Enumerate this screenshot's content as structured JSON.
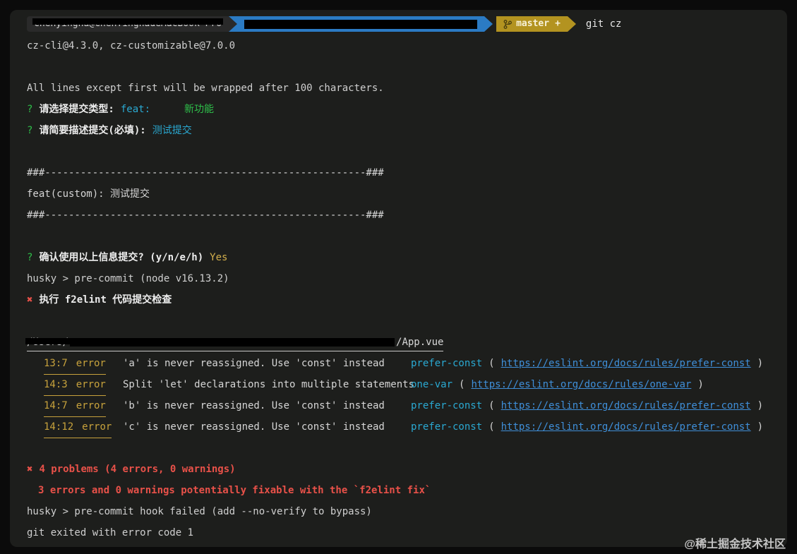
{
  "watermark": "@稀土掘金技术社区",
  "terminal": {
    "prompt": {
      "user_host": "chenyingha@ChenYinghadeMacBook-Pro",
      "branch": "master",
      "branch_dirty": "+",
      "command": "git cz"
    },
    "output": {
      "version_line": "cz-cli@4.3.0, cz-customizable@7.0.0",
      "wrap_notice": "All lines except first will be wrapped after 100 characters.",
      "question_mark": "?",
      "q_type_label": "请选择提交类型:",
      "q_type_value": "feat:",
      "q_type_desc": "新功能",
      "q_subject_label": "请简要描述提交(必填):",
      "q_subject_value": "测试提交",
      "divider": "###------------------------------------------------------###",
      "commit_message": "feat(custom): 测试提交",
      "q_confirm_label": "确认使用以上信息提交? (y/n/e/h)",
      "q_confirm_value": "Yes",
      "husky_precommit": "husky > pre-commit (node v16.13.2)",
      "cross_mark": "✖",
      "lint_running": "执行 f2elint 代码提交检查",
      "file_path_prefix": "/Users/",
      "file_path_suffix": "/App.vue",
      "paren_open": "(",
      "paren_close": ")",
      "problems_summary": "4 problems (4 errors, 0 warnings)",
      "fixable_note": "3 errors and 0 warnings potentially fixable with the `f2elint fix`",
      "hook_failed": "husky > pre-commit hook failed (add --no-verify to bypass)",
      "exit_line": "git exited with error code 1"
    },
    "errors": [
      {
        "pos": "13:7",
        "level": "error",
        "message": "'a' is never reassigned. Use 'const' instead",
        "rule": "prefer-const",
        "url": "https://eslint.org/docs/rules/prefer-const"
      },
      {
        "pos": "14:3",
        "level": "error",
        "message": "Split 'let' declarations into multiple statements",
        "rule": "one-var",
        "url": "https://eslint.org/docs/rules/one-var"
      },
      {
        "pos": "14:7",
        "level": "error",
        "message": "'b' is never reassigned. Use 'const' instead",
        "rule": "prefer-const",
        "url": "https://eslint.org/docs/rules/prefer-const"
      },
      {
        "pos": "14:12",
        "level": "error",
        "message": "'c' is never reassigned. Use 'const' instead",
        "rule": "prefer-const",
        "url": "https://eslint.org/docs/rules/prefer-const"
      }
    ]
  },
  "colors": {
    "terminal_bg": "#1d1e1c",
    "dir_segment_blue": "#2b7bc4",
    "git_segment_yellow": "#b39320",
    "error_red": "#e85149",
    "link_blue": "#3f8fd9",
    "rule_cyan": "#2aa9d2",
    "success_green": "#2ec04a",
    "answer_yellow": "#d4b04c"
  }
}
